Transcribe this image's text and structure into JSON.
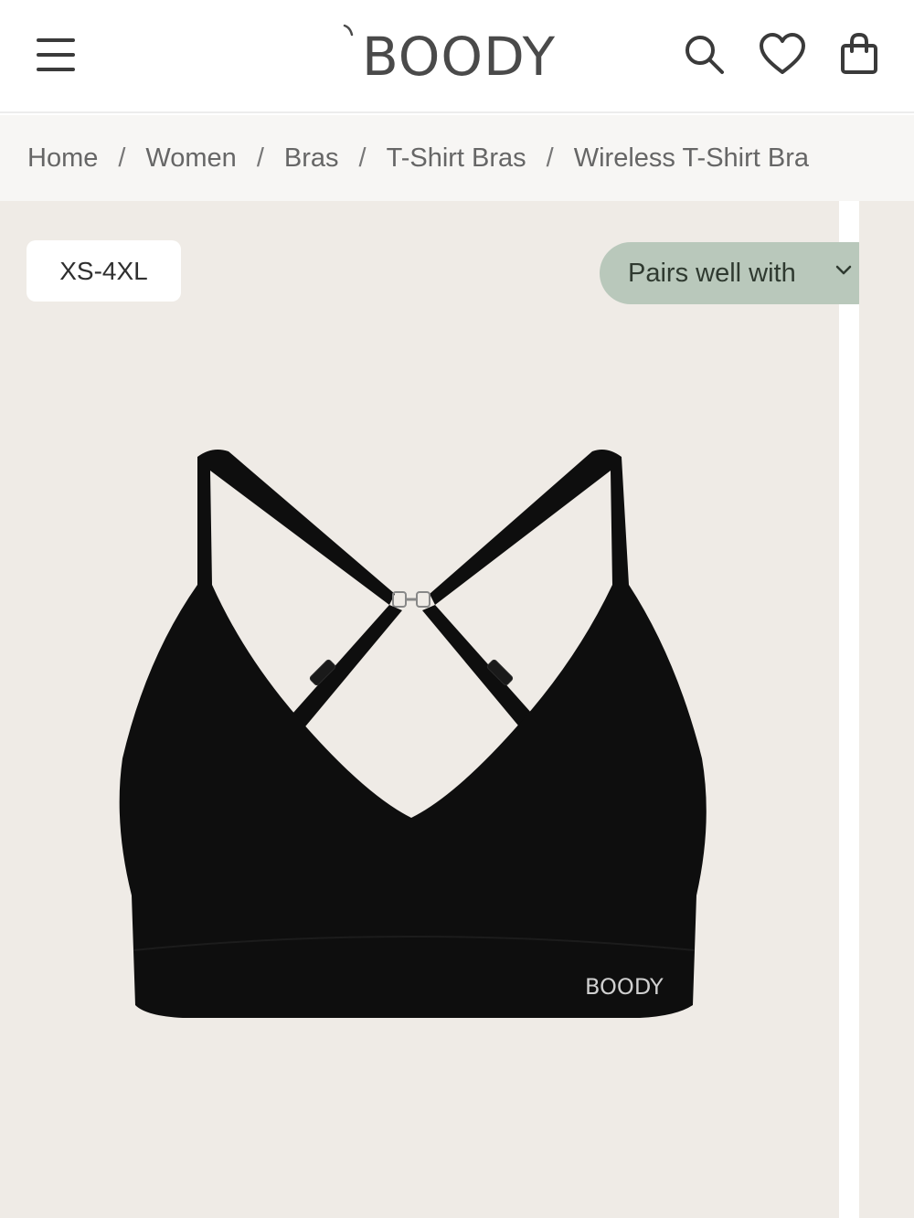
{
  "header": {
    "logo_text": "BOODY",
    "icons": [
      "menu-icon",
      "search-icon",
      "heart-icon",
      "shopping-bag-icon"
    ]
  },
  "breadcrumb": {
    "items": [
      "Home",
      "Women",
      "Bras",
      "T-Shirt Bras",
      "Wireless T-Shirt Bra"
    ],
    "separator": "/"
  },
  "gallery": {
    "size_badge": "XS-4XL",
    "pairs_button_label": "Pairs well with",
    "product_logo_text": "BOODY",
    "colors": {
      "background": "#efebe6",
      "pairs_button": "#b9c8bb",
      "product": "#0e0e0e"
    }
  }
}
